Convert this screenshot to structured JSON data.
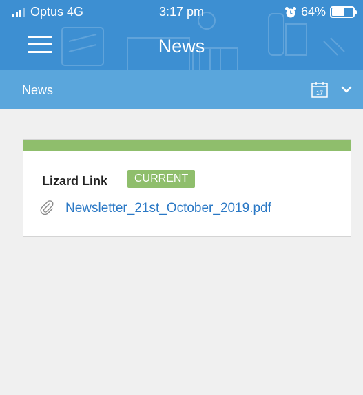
{
  "status_bar": {
    "carrier": "Optus 4G",
    "time": "3:17 pm",
    "battery": "64%",
    "battery_level": 0.64
  },
  "header": {
    "title": "News",
    "menu_icon": "hamburger-menu-icon"
  },
  "subheader": {
    "title": "News",
    "calendar_icon": "calendar-icon",
    "calendar_day": "17",
    "dropdown_icon": "chevron-down-icon"
  },
  "news_items": [
    {
      "title": "Lizard Link",
      "badge": "CURRENT",
      "attachment": "Newsletter_21st_October_2019.pdf",
      "attachment_icon": "paperclip-icon"
    }
  ],
  "colors": {
    "header": "#3d8fd2",
    "subheader": "#5aa6dc",
    "accent_green": "#8fbe6c",
    "link": "#2a78c5",
    "background": "#f0f0f0"
  }
}
